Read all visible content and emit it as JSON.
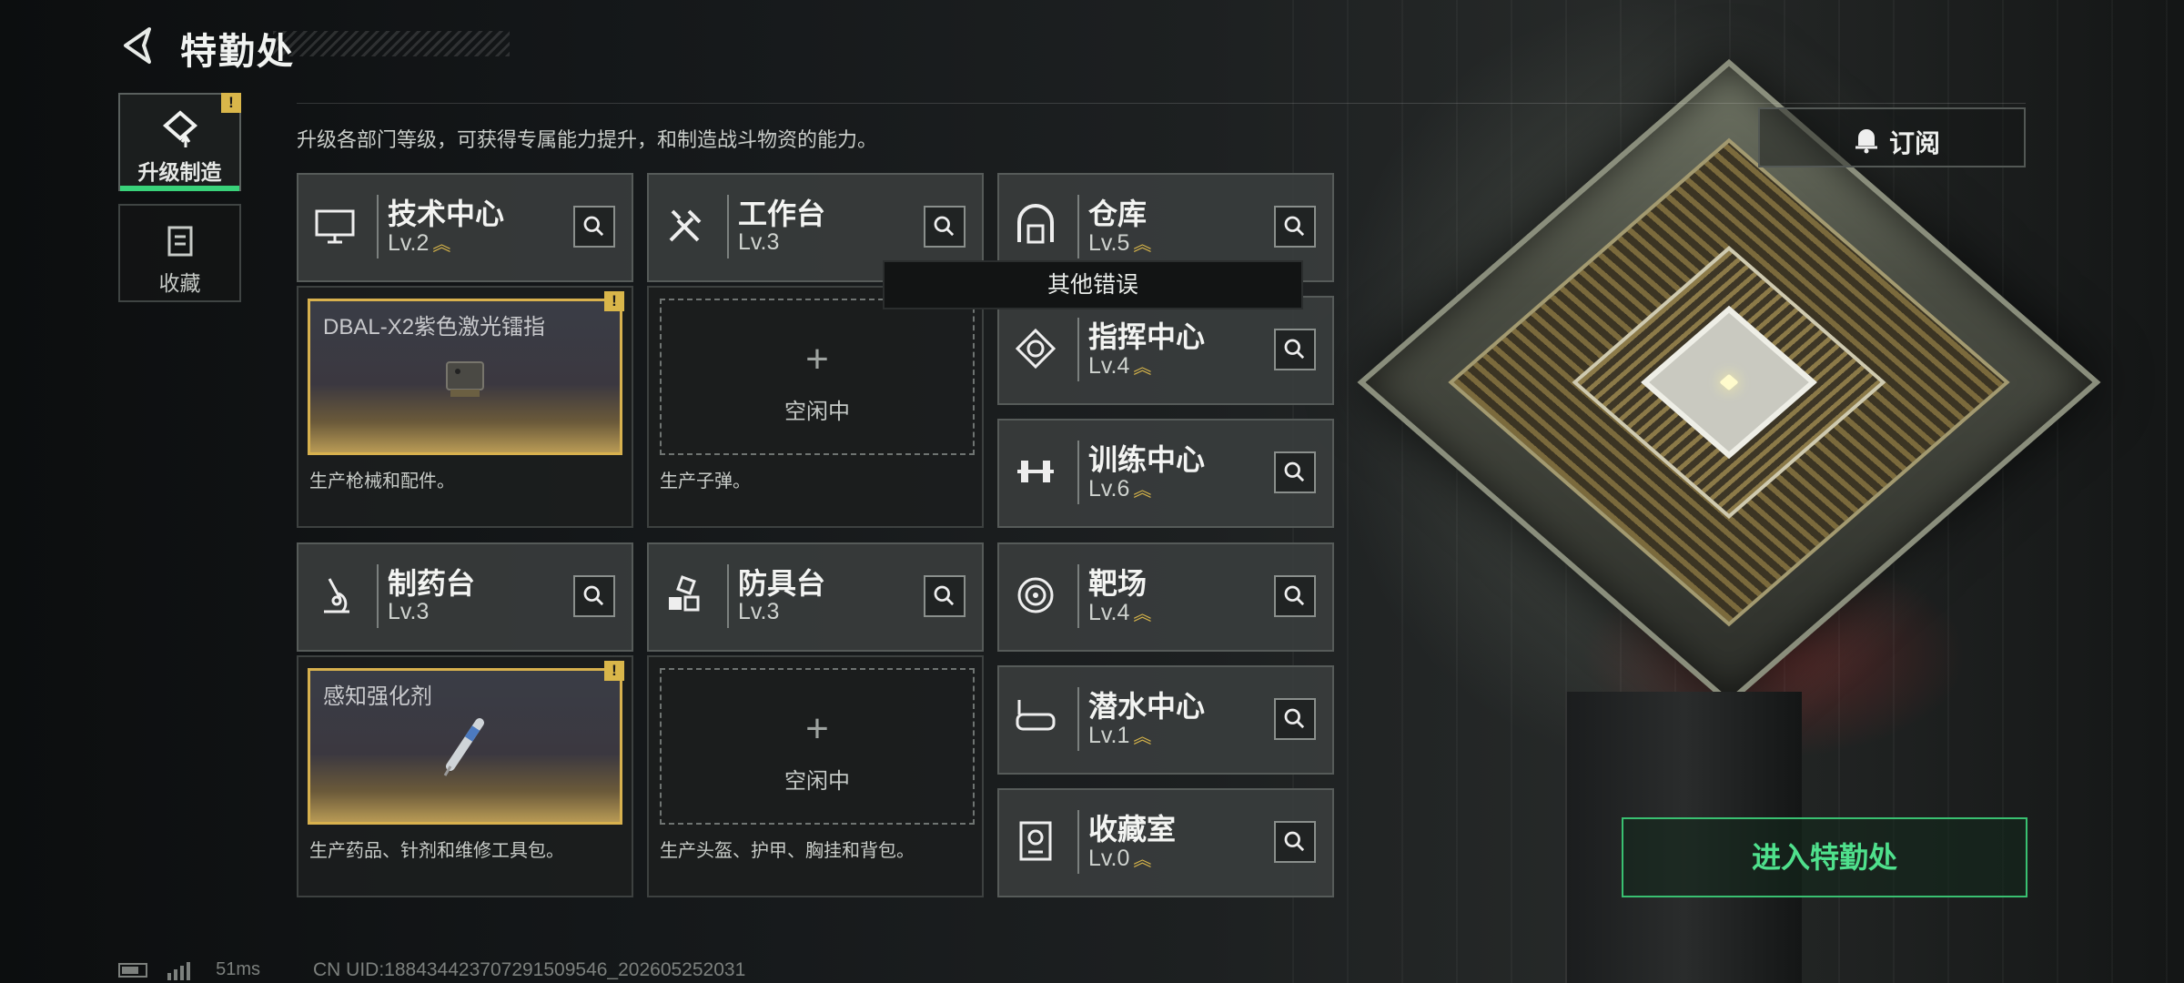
{
  "header": {
    "title": "特勤处",
    "back_icon": "back-arrow-icon"
  },
  "description": "升级各部门等级，可获得专属能力提升，和制造战斗物资的能力。",
  "side_tabs": [
    {
      "label": "升级制造",
      "icon": "upgrade-icon",
      "active": true,
      "badge": "!"
    },
    {
      "label": "收藏",
      "icon": "collection-icon",
      "active": false
    }
  ],
  "buildings": {
    "tech_center": {
      "name": "技术中心",
      "level": "Lv.2",
      "upgradable": true
    },
    "workbench": {
      "name": "工作台",
      "level": "Lv.3",
      "upgradable": false
    },
    "warehouse": {
      "name": "仓库",
      "level": "Lv.5",
      "upgradable": true
    },
    "command_center": {
      "name": "指挥中心",
      "level": "Lv.4",
      "upgradable": true
    },
    "training_center": {
      "name": "训练中心",
      "level": "Lv.6",
      "upgradable": true
    },
    "pharmacy": {
      "name": "制药台",
      "level": "Lv.3",
      "upgradable": false
    },
    "armor_bench": {
      "name": "防具台",
      "level": "Lv.3",
      "upgradable": false
    },
    "shooting_range": {
      "name": "靶场",
      "level": "Lv.4",
      "upgradable": true
    },
    "diving_center": {
      "name": "潜水中心",
      "level": "Lv.1",
      "upgradable": true
    },
    "collection_room": {
      "name": "收藏室",
      "level": "Lv.0",
      "upgradable": true
    }
  },
  "production": {
    "tech_center": {
      "item": "DBAL-X2紫色激光镭指",
      "desc": "生产枪械和配件。",
      "badge": "!"
    },
    "workbench": {
      "idle_plus": "+",
      "idle_label": "空闲中",
      "desc": "生产子弹。"
    },
    "pharmacy": {
      "item": "感知强化剂",
      "desc": "生产药品、针剂和维修工具包。",
      "badge": "!"
    },
    "armor_bench": {
      "idle_plus": "+",
      "idle_label": "空闲中",
      "desc": "生产头盔、护甲、胸挂和背包。"
    }
  },
  "tooltip": "其他错误",
  "subscribe_label": "订阅",
  "enter_button": "进入特勤处",
  "status_bar": {
    "ping": "51ms",
    "uid": "CN UID:18843442370729150954​6_202605252031"
  },
  "colors": {
    "accent_green": "#39c071",
    "gold": "#d9b64a"
  }
}
